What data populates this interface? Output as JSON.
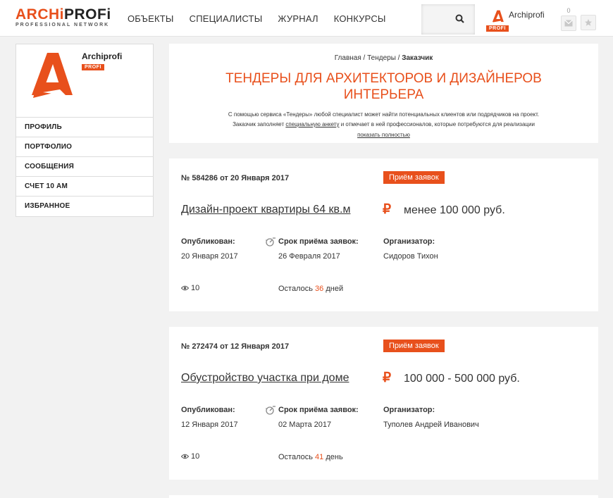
{
  "header": {
    "logo_part1": "ARCHi",
    "logo_part2": "PROFi",
    "logo_sub": "PROFESSIONAL NETWORK",
    "nav": [
      "ОБЪЕКТЫ",
      "СПЕЦИАЛИСТЫ",
      "ЖУРНАЛ",
      "КОНКУРСЫ"
    ],
    "user_name": "Archiprofi",
    "user_badge": "PROFI",
    "messages_count": "0"
  },
  "sidebar": {
    "name": "Archiprofi",
    "badge": "PROFI",
    "items": [
      "ПРОФИЛЬ",
      "ПОРТФОЛИО",
      "СООБЩЕНИЯ",
      "СЧЕТ 10 АМ",
      "ИЗБРАННОЕ"
    ]
  },
  "intro": {
    "breadcrumb": [
      "Главная",
      "Тендеры",
      "Заказчик"
    ],
    "breadcrumb_sep": " / ",
    "title": "ТЕНДЕРЫ ДЛЯ АРХИТЕКТОРОВ И ДИЗАЙНЕРОВ ИНТЕРЬЕРА",
    "text_line1": "С помощью сервиса «Тендеры» любой специалист может найти потенциальных клиентов или подрядчиков на проект.",
    "text_line2_a": "Заказчик заполняет ",
    "text_line2_link": "специальную анкету",
    "text_line2_b": " и отмечает в ней профессионалов, которые потребуются для реализации",
    "show_more": "показать полностью"
  },
  "labels": {
    "published": "Опубликован:",
    "deadline": "Срок приёма заявок:",
    "organizer": "Организатор:",
    "left_prefix": "Осталось "
  },
  "tenders": [
    {
      "number": "№ 584286 от 20 Января 2017",
      "status": "Приём заявок",
      "title": "Дизайн-проект квартиры 64 кв.м",
      "currency": "₽",
      "price": "менее 100 000 руб.",
      "published": "20 Января 2017",
      "deadline": "26 Февраля 2017",
      "organizer": "Сидоров Тихон",
      "views": "10",
      "left_num": "36",
      "left_unit": " дней"
    },
    {
      "number": "№ 272474 от 12 Января 2017",
      "status": "Приём заявок",
      "title": "Обустройство участка при доме",
      "currency": "₽",
      "price": "100 000 - 500 000 руб.",
      "published": "12 Января 2017",
      "deadline": "02 Марта 2017",
      "organizer": "Туполев Андрей Иванович",
      "views": "10",
      "left_num": "41",
      "left_unit": " день"
    }
  ],
  "colors": {
    "accent": "#e8501c",
    "background": "#f2f2f2"
  }
}
